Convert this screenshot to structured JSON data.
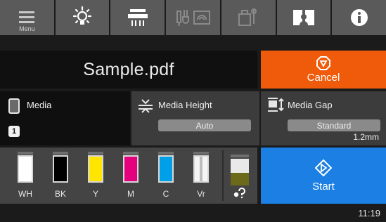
{
  "toolbar": {
    "menu_label": "Menu",
    "buttons": [
      {
        "name": "menu",
        "icon": "menu-icon"
      },
      {
        "name": "light",
        "icon": "lightbulb-icon"
      },
      {
        "name": "printhead",
        "icon": "printhead-icon"
      },
      {
        "name": "network",
        "icon": "network-status-icon"
      },
      {
        "name": "maintenance",
        "icon": "maintenance-icon"
      },
      {
        "name": "manual",
        "icon": "manual-book-icon"
      },
      {
        "name": "info",
        "icon": "info-icon"
      }
    ]
  },
  "job": {
    "file_name": "Sample.pdf",
    "cancel_label": "Cancel"
  },
  "media": {
    "media_label": "Media",
    "media_number": "1",
    "height_label": "Media Height",
    "height_value": "Auto",
    "gap_label": "Media Gap",
    "gap_value": "Standard",
    "gap_measure": "1.2mm"
  },
  "inks": [
    {
      "code": "WH",
      "color": "#ffffff",
      "level": 0.55
    },
    {
      "code": "BK",
      "color": "#000000",
      "level": 1.0
    },
    {
      "code": "Y",
      "color": "#ffe500",
      "level": 1.0
    },
    {
      "code": "M",
      "color": "#e5007e",
      "level": 1.0
    },
    {
      "code": "C",
      "color": "#00a0e8",
      "level": 1.0
    },
    {
      "code": "Vr",
      "color": "#ffffff",
      "level": 1.0
    }
  ],
  "maintenance": {
    "color": "#6a6a1a",
    "icon": "maintenance-box-icon"
  },
  "start_label": "Start",
  "status": {
    "time": "11:19"
  },
  "colors": {
    "cancel": "#f05b0b",
    "start": "#1b7fe3",
    "toolbar": "#5a5a5a"
  }
}
